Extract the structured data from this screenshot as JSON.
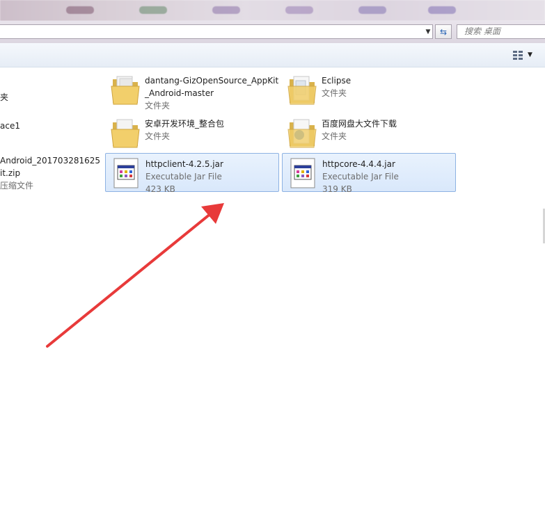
{
  "addressbar": {
    "search_placeholder": "搜索 桌面"
  },
  "icons": {
    "dropdown": "chevron-down-icon",
    "refresh": "refresh-icon",
    "view": "view-options-icon",
    "folder": "folder-icon",
    "jar": "jar-file-icon",
    "annotation": "red-arrow"
  },
  "left_partial": {
    "item1_type": "夹",
    "item2_name": "ace1",
    "item3_name_line1": "Android_201703281625",
    "item3_name_line2": "it.zip",
    "item3_type": "压缩文件"
  },
  "files": [
    {
      "name_line1": "dantang-GizOpenSource_AppKit",
      "name_line2": "_Android-master",
      "type": "文件夹"
    },
    {
      "name": "Eclipse",
      "type": "文件夹"
    },
    {
      "name": "安卓开发环境_整合包",
      "type": "文件夹"
    },
    {
      "name": "百度网盘大文件下载",
      "type": "文件夹"
    },
    {
      "name": "httpclient-4.2.5.jar",
      "type": "Executable Jar File",
      "size": "423 KB"
    },
    {
      "name": "httpcore-4.4.4.jar",
      "type": "Executable Jar File",
      "size": "319 KB"
    }
  ],
  "colors": {
    "selection_border": "#8db2e3",
    "selection_fill": "#dce9fb",
    "arrow": "#e83a3a"
  }
}
